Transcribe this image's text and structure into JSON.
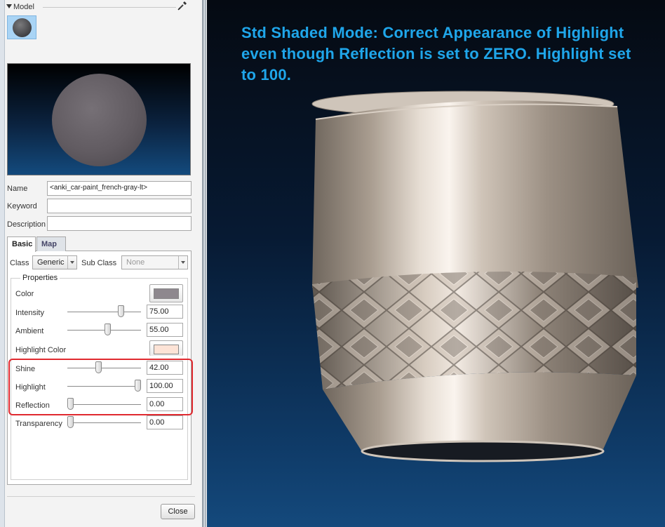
{
  "panel": {
    "section_title": "Model",
    "name_label": "Name",
    "name_value": "<anki_car-paint_french-gray-lt>",
    "keyword_label": "Keyword",
    "keyword_value": "",
    "description_label": "Description",
    "description_value": "",
    "tabs": [
      {
        "label": "Basic",
        "active": true
      },
      {
        "label": "Map",
        "active": false
      }
    ],
    "class_label": "Class",
    "class_value": "Generic",
    "subclass_label": "Sub Class",
    "subclass_value": "None",
    "properties_title": "Properties",
    "properties": {
      "color": {
        "label": "Color",
        "swatch": "#8e888e"
      },
      "intensity": {
        "label": "Intensity",
        "value": "75.00",
        "level": 75
      },
      "ambient": {
        "label": "Ambient",
        "value": "55.00",
        "level": 55
      },
      "highlight_color": {
        "label": "Highlight Color",
        "swatch": "#fde3d6"
      },
      "shine": {
        "label": "Shine",
        "value": "42.00",
        "level": 42
      },
      "highlight": {
        "label": "Highlight",
        "value": "100.00",
        "level": 100
      },
      "reflection": {
        "label": "Reflection",
        "value": "0.00",
        "level": 0
      },
      "transparency": {
        "label": "Transparency",
        "value": "0.00",
        "level": 0
      }
    },
    "close_label": "Close"
  },
  "viewport": {
    "caption": "Std Shaded Mode:  Correct Appearance of Highlight even though Reflection is set to ZERO.  Highlight set to 100.",
    "caption_color": "#1fa6ea"
  },
  "colors": {
    "annotation_box": "#e0292f"
  }
}
